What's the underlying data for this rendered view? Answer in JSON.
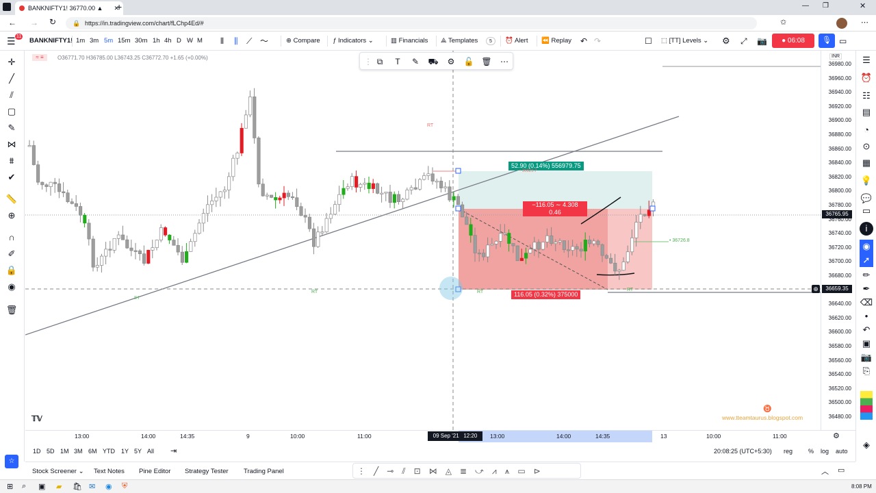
{
  "browser": {
    "tab_title": "BANKNIFTY1! 36770.00 ▲",
    "url": "https://in.tradingview.com/chart/fLChp4Ed/#"
  },
  "toolbar": {
    "symbol": "BANKNIFTY1!",
    "intervals": [
      "1m",
      "3m",
      "5m",
      "15m",
      "30m",
      "1h",
      "4h",
      "D",
      "W",
      "M"
    ],
    "compare": "Compare",
    "indicators": "Indicators",
    "financials": "Financials",
    "templates": "Templates",
    "templates_count": "5",
    "alert": "Alert",
    "replay": "Replay",
    "levels": "[TT] Levels",
    "timer": "06:08",
    "notif_count": "11"
  },
  "legend": {
    "ohlc": "O36771.70  H36785.00  L36743.25  C36772.70  +1.65 (+0.00%)"
  },
  "chart": {
    "rt_labels": [
      "RT",
      "RT",
      "RT",
      "RT"
    ],
    "ih_label": "IH",
    "target_label": "52.90 (0.14%) 556979.75",
    "pnl_label_1": "−116.05 ∼ 4.308",
    "pnl_label_2": "0.46",
    "stop_label": "116.05 (0.32%) 375000",
    "green_level": "• 36726.8",
    "small_label": "• 36823.7",
    "watermark": "www.tteamtaurus.blogspot.com"
  },
  "price_axis": {
    "currency": "INR",
    "ticks": [
      "36980.00",
      "36960.00",
      "36940.00",
      "36920.00",
      "36900.00",
      "36880.00",
      "36860.00",
      "36840.00",
      "36820.00",
      "36800.00",
      "36780.00",
      "36760.00",
      "36740.00",
      "36720.00",
      "36700.00",
      "36680.00",
      "36660.00",
      "36640.00",
      "36620.00",
      "36600.00",
      "36580.00",
      "36560.00",
      "36540.00",
      "36520.00",
      "36500.00",
      "36480.00"
    ],
    "current_price": "36765.95",
    "cursor_price": "36659.35"
  },
  "time_axis": {
    "ticks": [
      "13:00",
      "14:00",
      "14:35",
      "9",
      "10:00",
      "11:00",
      "13:00",
      "14:00",
      "14:35",
      "13",
      "10:00",
      "11:00"
    ],
    "cursor_time": "09 Sep '21   12:20"
  },
  "range_bar": {
    "ranges": [
      "1D",
      "5D",
      "1M",
      "3M",
      "6M",
      "YTD",
      "1Y",
      "5Y",
      "All"
    ],
    "clock": "20:08:25 (UTC+5:30)",
    "reg": "reg",
    "pct": "%",
    "log": "log",
    "auto": "auto"
  },
  "bottom_panel": {
    "tabs": [
      "Stock Screener",
      "Text Notes",
      "Pine Editor",
      "Strategy Tester",
      "Trading Panel"
    ]
  },
  "taskbar": {
    "time": "8:08 PM"
  },
  "colors": {
    "up": "#26a69a",
    "down": "#ef5350",
    "green_bar": "#22ab1c",
    "red_bar": "#e31b23",
    "neutral": "#9e9e9e",
    "accent": "#2962ff"
  }
}
